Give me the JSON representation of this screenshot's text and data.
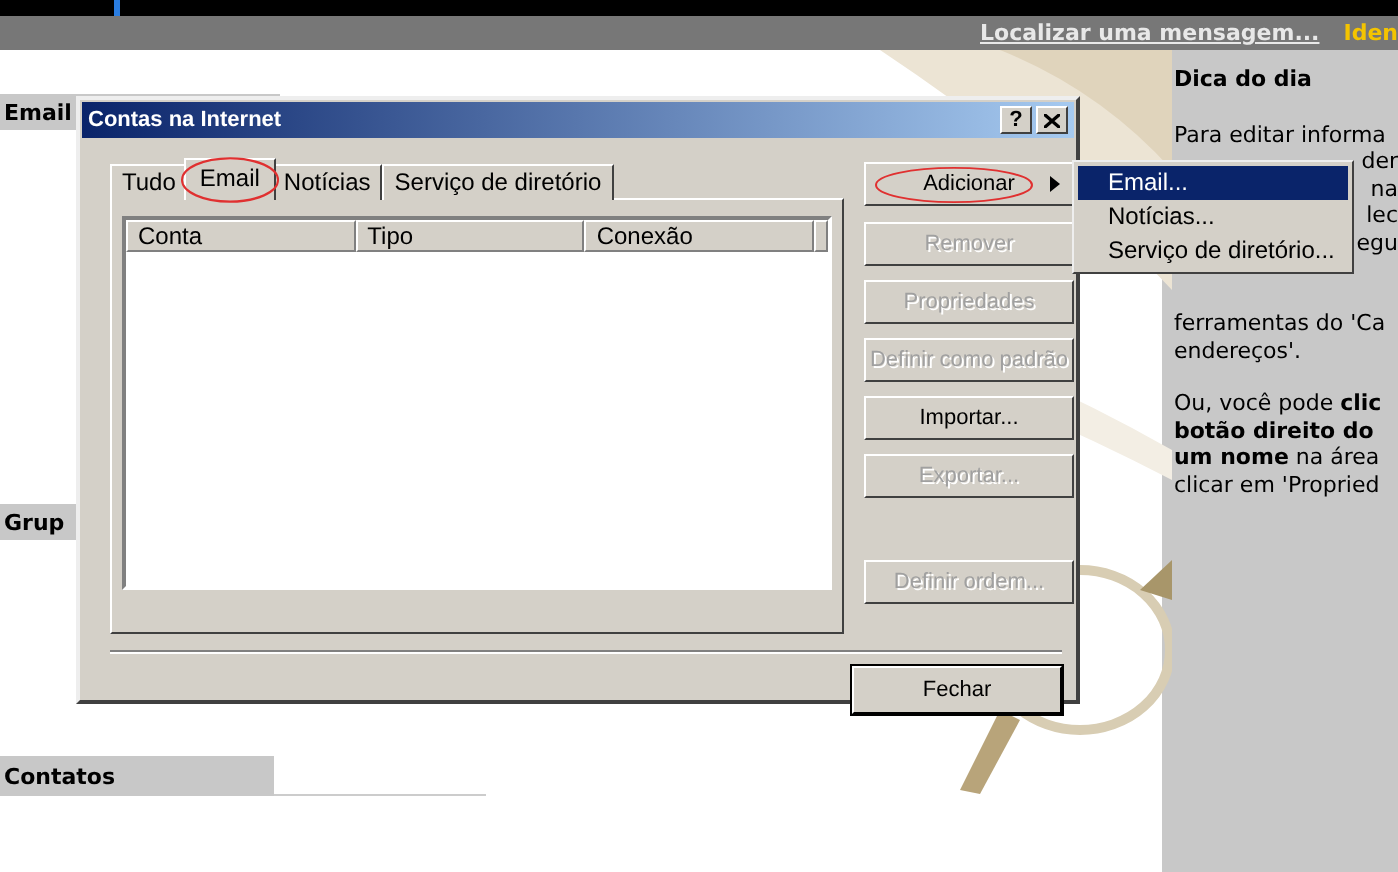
{
  "top_bar": {
    "links": [
      {
        "text": "Localizar uma mensagem...",
        "kind": "link"
      },
      {
        "text": "Iden",
        "kind": "highlight"
      }
    ]
  },
  "sections": [
    {
      "label": "Email"
    },
    {
      "label": "Grup"
    },
    {
      "label": "Contatos"
    }
  ],
  "tip": {
    "title": "Dica do dia",
    "lines": [
      {
        "text": "Para editar informa",
        "kind": "full"
      },
      {
        "text": "der",
        "kind": "tail"
      },
      {
        "text": "na",
        "kind": "tail"
      },
      {
        "text": "lec",
        "kind": "tail"
      },
      {
        "text": "egu",
        "kind": "tail"
      },
      {
        "text": "ferramentas do 'Ca",
        "kind": "full"
      },
      {
        "text": "endereços'.",
        "kind": "full"
      },
      {
        "text": "Ou, você pode **clic**",
        "kind": "gap"
      },
      {
        "text": "**botão direito do**",
        "kind": "full"
      },
      {
        "text": "**um nome** na área",
        "kind": "full"
      },
      {
        "text": "clicar em 'Propried",
        "kind": "full"
      }
    ]
  },
  "dialog": {
    "title": "Contas na Internet",
    "help_button": "?",
    "tabs": [
      {
        "label": "Tudo",
        "selected": false,
        "circled": false
      },
      {
        "label": "Email",
        "selected": true,
        "circled": true
      },
      {
        "label": "Notícias",
        "selected": false,
        "circled": false
      },
      {
        "label": "Serviço de diretório",
        "selected": false,
        "circled": false
      }
    ],
    "columns": [
      "Conta",
      "Tipo",
      "Conexão"
    ],
    "buttons": [
      {
        "label": "Adicionar",
        "disabled": false,
        "kind": "submenu",
        "circled": true
      },
      {
        "label": "Remover",
        "disabled": true,
        "kind": "plain",
        "circled": false
      },
      {
        "label": "Propriedades",
        "disabled": true,
        "kind": "plain",
        "circled": false
      },
      {
        "label": "Definir como padrão",
        "disabled": true,
        "kind": "plain",
        "circled": false
      },
      {
        "label": "Importar...",
        "disabled": false,
        "kind": "plain",
        "circled": false
      },
      {
        "label": "Exportar...",
        "disabled": true,
        "kind": "plain",
        "circled": false
      },
      {
        "label": "Definir ordem...",
        "disabled": true,
        "kind": "bottom",
        "circled": false
      }
    ],
    "close_button": "Fechar"
  },
  "menu": {
    "items": [
      {
        "label": "Email...",
        "selected": true
      },
      {
        "label": "Notícias...",
        "selected": false
      },
      {
        "label": "Serviço de diretório...",
        "selected": false
      }
    ]
  }
}
